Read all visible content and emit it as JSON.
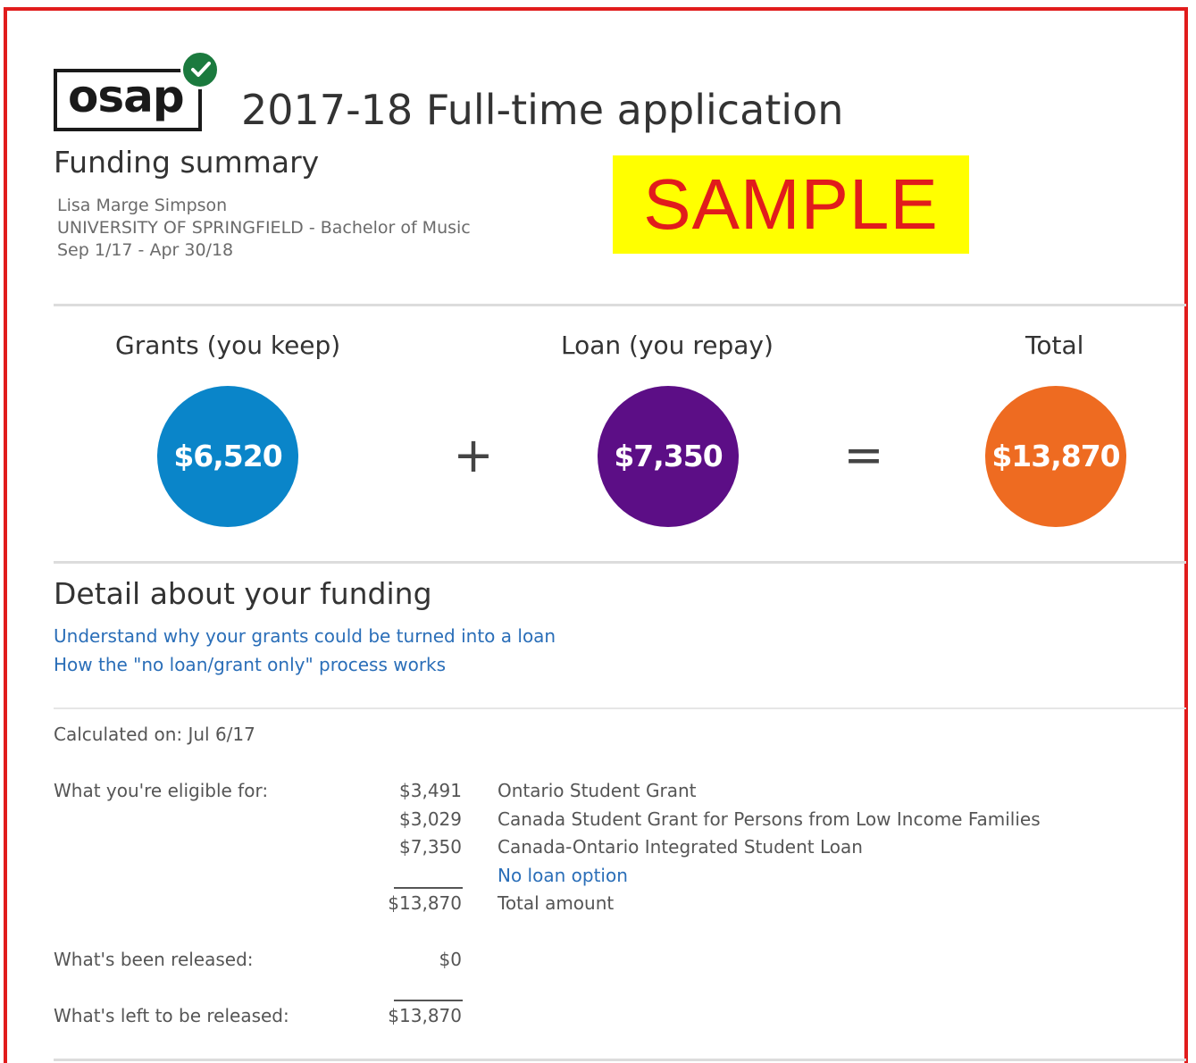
{
  "header": {
    "logo_text": "osap",
    "app_title": "2017-18 Full-time application",
    "summary_title": "Funding summary",
    "student_name": "Lisa Marge Simpson",
    "program": "UNIVERSITY OF SPRINGFIELD - Bachelor of Music",
    "period": "Sep 1/17 - Apr 30/18",
    "watermark": "SAMPLE",
    "watermark_bg": "#ffff00",
    "watermark_color": "#e11c1c"
  },
  "summary": {
    "grants_label": "Grants (you keep)",
    "grants_amount": "$6,520",
    "grants_color": "#0a85c9",
    "plus_symbol": "+",
    "loan_label": "Loan (you repay)",
    "loan_amount": "$7,350",
    "loan_color": "#5c0e86",
    "equals_symbol": "=",
    "total_label": "Total",
    "total_amount": "$13,870",
    "total_color": "#ee6b21"
  },
  "detail": {
    "title": "Detail about your funding",
    "link_grants_to_loan": "Understand why your grants could be turned into a loan",
    "link_no_loan_process": "How the \"no loan/grant only\" process works",
    "calculated_on": "Calculated on: Jul 6/17",
    "eligible_label": "What you're eligible for:",
    "eligible_items": [
      {
        "amount": "$3,491",
        "description": "Ontario Student Grant"
      },
      {
        "amount": "$3,029",
        "description": "Canada Student Grant for Persons from Low Income Families"
      },
      {
        "amount": "$7,350",
        "description": "Canada-Ontario Integrated Student Loan"
      }
    ],
    "no_loan_option": "No loan option",
    "total_amount": "$13,870",
    "total_label": "Total amount",
    "released_label": "What's been released:",
    "released_amount": "$0",
    "left_label": "What's left to be released:",
    "left_amount": "$13,870"
  }
}
